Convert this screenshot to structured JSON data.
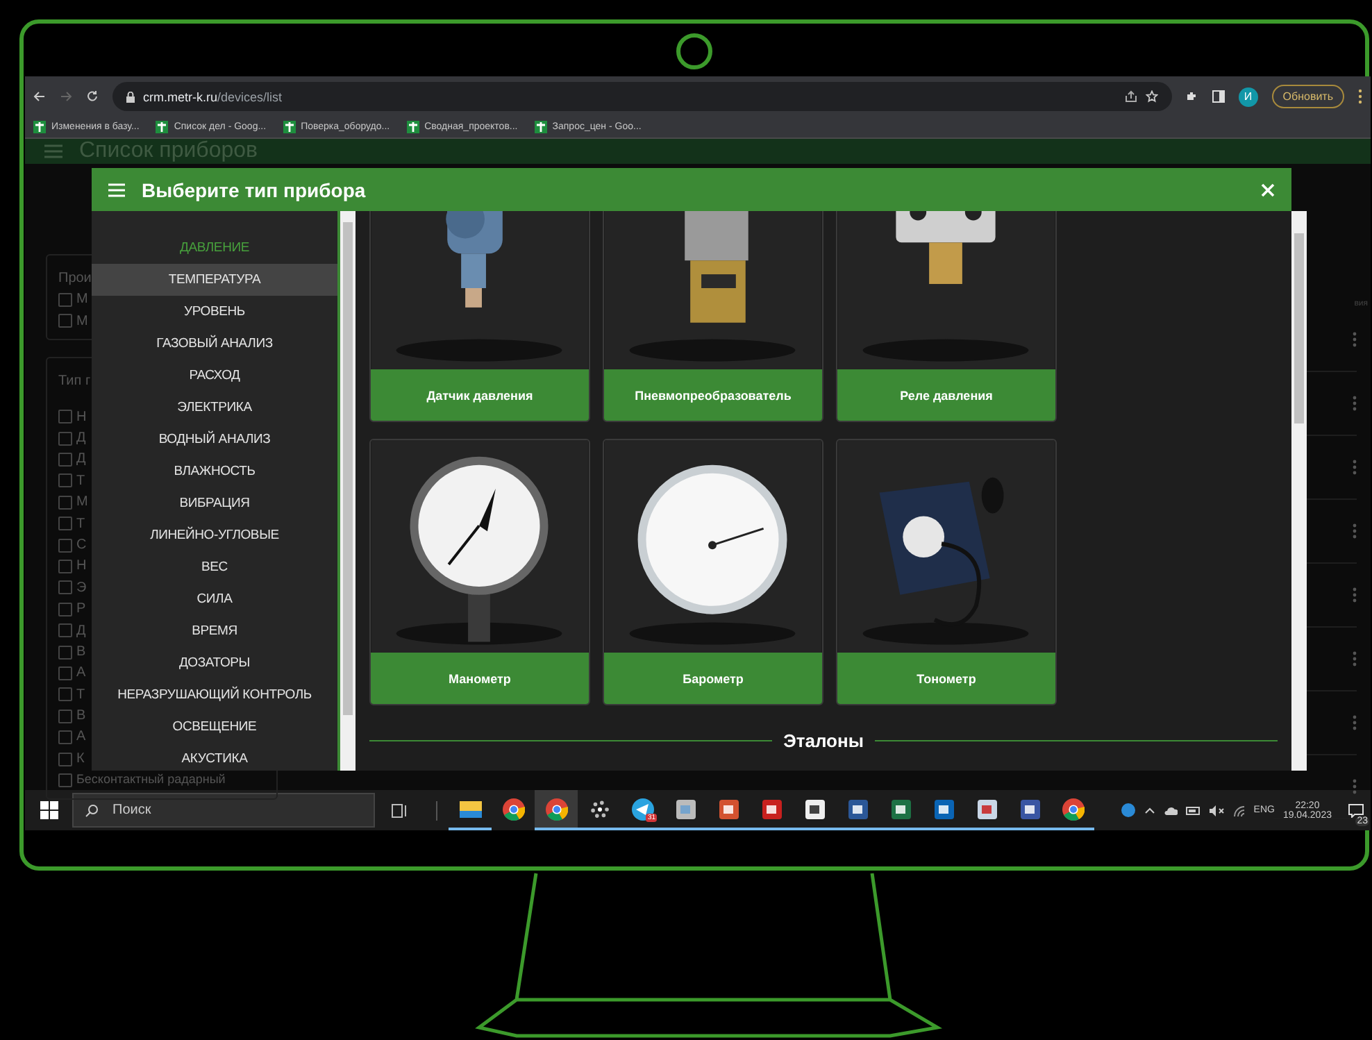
{
  "browser": {
    "url_host": "crm.metr-k.ru",
    "url_path": "/devices/list",
    "profile_initial": "И",
    "update_button": "Обновить",
    "bookmarks": [
      "Изменения в базу...",
      "Список дел - Goog...",
      "Поверка_оборудо...",
      "Сводная_проектов...",
      "Запрос_цен - Goo..."
    ]
  },
  "app": {
    "title": "Список приборов",
    "manufacturer_panel": {
      "title": "Прои",
      "options": [
        {
          "label": "М",
          "checked": false
        },
        {
          "label": "М",
          "checked": false
        }
      ]
    },
    "type_panel": {
      "title": "Тип г",
      "options": [
        {
          "label": "Н",
          "checked": false
        },
        {
          "label": "Д",
          "checked": false
        },
        {
          "label": "Д",
          "checked": false
        },
        {
          "label": "Т",
          "checked": false
        },
        {
          "label": "М",
          "checked": false
        },
        {
          "label": "Т",
          "checked": false
        },
        {
          "label": "С",
          "checked": false
        },
        {
          "label": "Н",
          "checked": false
        },
        {
          "label": "Э",
          "checked": false
        },
        {
          "label": "Р",
          "checked": false
        },
        {
          "label": "Д",
          "checked": false
        },
        {
          "label": "В",
          "checked": false
        },
        {
          "label": "А",
          "checked": false
        },
        {
          "label": "Т",
          "checked": false
        },
        {
          "label": "В",
          "checked": false
        },
        {
          "label": "А",
          "checked": false
        },
        {
          "label": "К",
          "checked": false
        },
        {
          "label": "Бесконтактный радарный",
          "checked": false
        }
      ]
    },
    "table_column": "вия"
  },
  "modal": {
    "title": "Выберите тип прибора",
    "categories": [
      {
        "label": "ДАВЛЕНИЕ",
        "selected": true,
        "hovered": false
      },
      {
        "label": "ТЕМПЕРАТУРА",
        "selected": false,
        "hovered": true
      },
      {
        "label": "УРОВЕНЬ",
        "selected": false,
        "hovered": false
      },
      {
        "label": "ГАЗОВЫЙ АНАЛИЗ",
        "selected": false,
        "hovered": false
      },
      {
        "label": "РАСХОД",
        "selected": false,
        "hovered": false
      },
      {
        "label": "ЭЛЕКТРИКА",
        "selected": false,
        "hovered": false
      },
      {
        "label": "ВОДНЫЙ АНАЛИЗ",
        "selected": false,
        "hovered": false
      },
      {
        "label": "ВЛАЖНОСТЬ",
        "selected": false,
        "hovered": false
      },
      {
        "label": "ВИБРАЦИЯ",
        "selected": false,
        "hovered": false
      },
      {
        "label": "ЛИНЕЙНО-УГЛОВЫЕ",
        "selected": false,
        "hovered": false
      },
      {
        "label": "ВЕС",
        "selected": false,
        "hovered": false
      },
      {
        "label": "СИЛА",
        "selected": false,
        "hovered": false
      },
      {
        "label": "ВРЕМЯ",
        "selected": false,
        "hovered": false
      },
      {
        "label": "ДОЗАТОРЫ",
        "selected": false,
        "hovered": false
      },
      {
        "label": "НЕРАЗРУШАЮЩИЙ КОНТРОЛЬ",
        "selected": false,
        "hovered": false
      },
      {
        "label": "ОСВЕЩЕНИЕ",
        "selected": false,
        "hovered": false
      },
      {
        "label": "АКУСТИКА",
        "selected": false,
        "hovered": false
      }
    ],
    "cards": [
      {
        "name": "Датчик давления",
        "kind": "picture"
      },
      {
        "name": "Пневмопреобразователь",
        "kind": "picture"
      },
      {
        "name": "Реле давления",
        "kind": "picture"
      },
      {
        "name": "Манометр",
        "kind": "picture"
      },
      {
        "name": "Барометр",
        "kind": "picture"
      },
      {
        "name": "Тонометр",
        "kind": "picture"
      }
    ],
    "section_title": "Эталоны"
  },
  "taskbar": {
    "search_placeholder": "Поиск",
    "apps": [
      {
        "kind": "folder",
        "running": true,
        "selected": false
      },
      {
        "kind": "chrome",
        "running": false,
        "selected": false
      },
      {
        "kind": "chrome",
        "running": true,
        "selected": true
      },
      {
        "kind": "sparkle",
        "running": true,
        "selected": false
      },
      {
        "kind": "telegram",
        "running": true,
        "selected": false,
        "badge": "31"
      },
      {
        "kind": "monitor",
        "running": true,
        "selected": false
      },
      {
        "kind": "powerpoint",
        "running": true,
        "selected": false
      },
      {
        "kind": "pdf",
        "running": true,
        "selected": false
      },
      {
        "kind": "archive",
        "running": true,
        "selected": false
      },
      {
        "kind": "word",
        "running": true,
        "selected": false
      },
      {
        "kind": "excel",
        "running": true,
        "selected": false
      },
      {
        "kind": "outlook",
        "running": true,
        "selected": false
      },
      {
        "kind": "chart",
        "running": true,
        "selected": false
      },
      {
        "kind": "visio",
        "running": true,
        "selected": false
      },
      {
        "kind": "chrome",
        "running": true,
        "selected": false
      }
    ],
    "language": "ENG",
    "time": "22:20",
    "date": "19.04.2023",
    "notifications": "23"
  }
}
